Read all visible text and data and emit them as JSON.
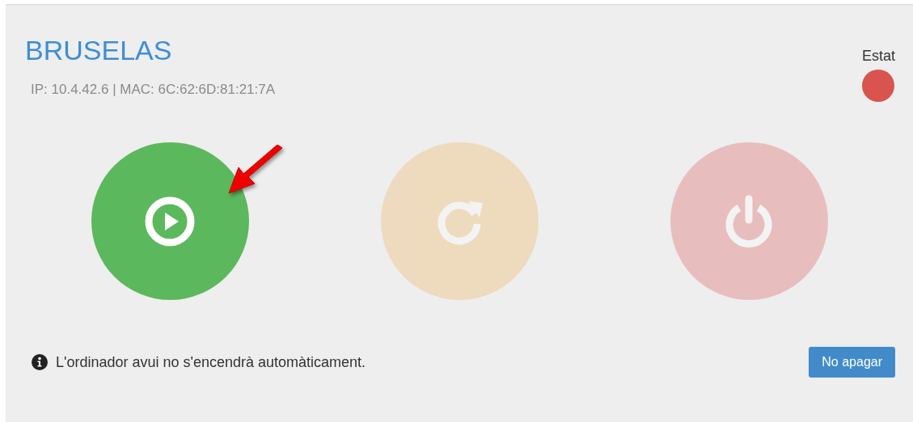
{
  "title": "BRUSELAS",
  "info": "IP: 10.4.42.6 | MAC: 6C:62:6D:81:21:7A",
  "status": {
    "label": "Estat",
    "color": "#d9534f"
  },
  "actions": [
    {
      "kind": "start",
      "disabled": false
    },
    {
      "kind": "restart",
      "disabled": true
    },
    {
      "kind": "shutdown",
      "disabled": true
    }
  ],
  "notice": "L'ordinador avui no s'encendrà automàticament.",
  "button": "No apagar"
}
